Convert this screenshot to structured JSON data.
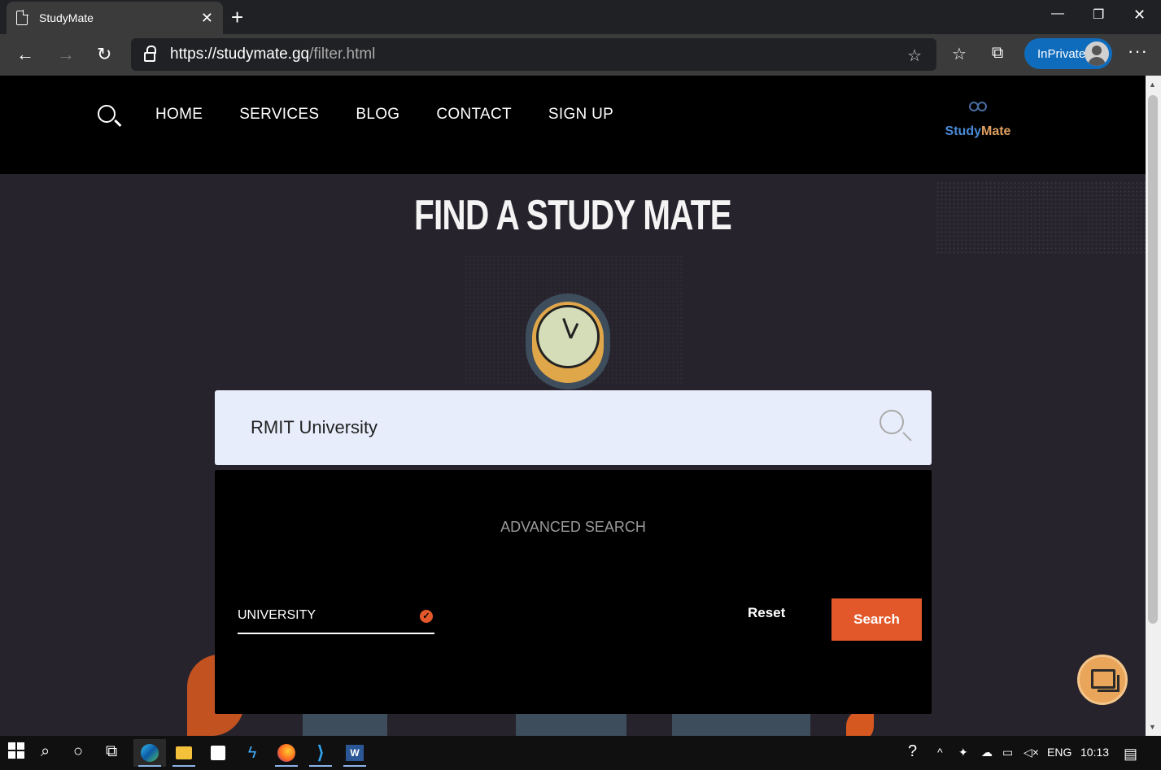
{
  "browser": {
    "tab_title": "StudyMate",
    "url_main": "https://studymate.gq",
    "url_path": "/filter.html",
    "inprivate_label": "InPrivate"
  },
  "site": {
    "nav": [
      "HOME",
      "SERVICES",
      "BLOG",
      "CONTACT",
      "SIGN UP"
    ],
    "brand_prefix": "Study",
    "brand_suffix": "Mate"
  },
  "hero": {
    "title": "FIND A STUDY MATE"
  },
  "search": {
    "value": "RMIT University"
  },
  "advanced": {
    "title": "ADVANCED SEARCH",
    "field_value": "UNIVERSITY",
    "reset_label": "Reset",
    "search_label": "Search"
  },
  "taskbar": {
    "language": "ENG",
    "time": "10:13"
  }
}
